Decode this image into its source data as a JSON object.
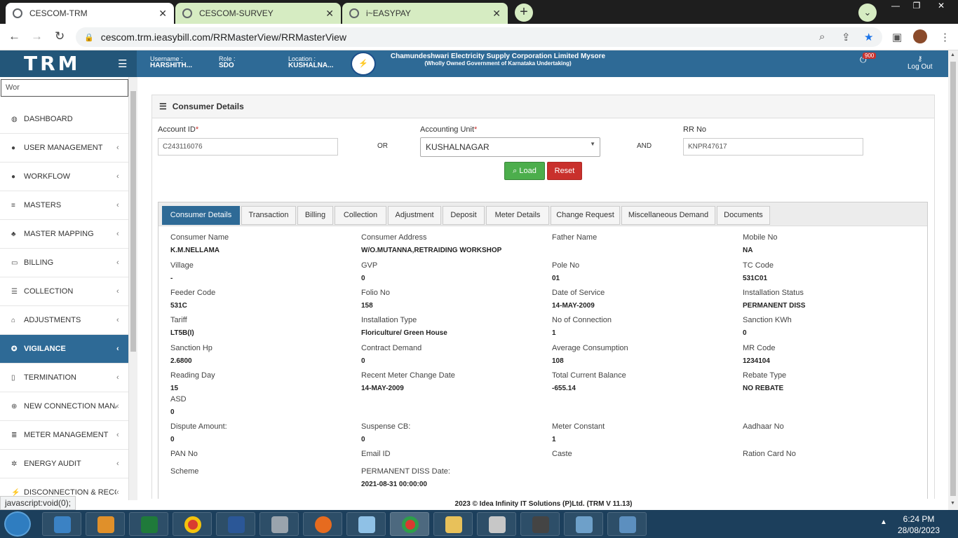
{
  "browser": {
    "tabs": [
      {
        "label": "CESCOM-TRM",
        "active": true
      },
      {
        "label": "CESCOM-SURVEY",
        "active": false
      },
      {
        "label": "i~EASYPAY",
        "active": false
      }
    ],
    "url": "cescom.trm.ieasybill.com/RRMasterView/RRMasterView",
    "status_url": "javascript:void(0);"
  },
  "header": {
    "logo": "TRM",
    "username_label": "Username :",
    "username_value": "HARSHITH...",
    "role_label": "Role :",
    "role_value": "SDO",
    "location_label": "Location :",
    "location_value": "KUSHALNA...",
    "corp_name": "Chamundeshwari Electricity Supply Corporation Limited Mysore",
    "corp_sub": "(Wholly Owned Government of Karnataka Undertaking)",
    "notif_count": "900",
    "logout": "Log Out"
  },
  "sidebar": {
    "search_value": "Wor",
    "items": [
      {
        "label": "DASHBOARD",
        "icon": "dashboard-icon",
        "glyph": "◍",
        "chevron": false
      },
      {
        "label": "USER MANAGEMENT",
        "icon": "user-icon",
        "glyph": "●",
        "chevron": true
      },
      {
        "label": "WORKFLOW",
        "icon": "user-icon",
        "glyph": "●",
        "chevron": true
      },
      {
        "label": "MASTERS",
        "icon": "list-icon",
        "glyph": "≡",
        "chevron": true
      },
      {
        "label": "MASTER MAPPING",
        "icon": "sitemap-icon",
        "glyph": "♣",
        "chevron": true
      },
      {
        "label": "BILLING",
        "icon": "monitor-icon",
        "glyph": "▭",
        "chevron": true
      },
      {
        "label": "COLLECTION",
        "icon": "list-icon",
        "glyph": "☰",
        "chevron": true
      },
      {
        "label": "ADJUSTMENTS",
        "icon": "binoculars-icon",
        "glyph": "⌂",
        "chevron": true
      },
      {
        "label": "VIGILANCE",
        "icon": "vigilance-icon",
        "glyph": "✪",
        "chevron": true,
        "active": true
      },
      {
        "label": "TERMINATION",
        "icon": "trash-icon",
        "glyph": "▯",
        "chevron": true
      },
      {
        "label": "NEW CONNECTION MANA...",
        "icon": "plus-circle-icon",
        "glyph": "⊕",
        "chevron": true
      },
      {
        "label": "METER MANAGEMENT",
        "icon": "list-icon",
        "glyph": "≣",
        "chevron": true
      },
      {
        "label": "ENERGY AUDIT",
        "icon": "cogs-icon",
        "glyph": "✲",
        "chevron": true
      },
      {
        "label": "DISCONNECTION & RECO...",
        "icon": "plug-icon",
        "glyph": "⚡",
        "chevron": true
      }
    ]
  },
  "panel": {
    "title": "Consumer Details",
    "account_label": "Account ID",
    "account_value": "C243116076",
    "or": "OR",
    "acct_unit_label": "Accounting Unit",
    "acct_unit_value": "KUSHALNAGAR",
    "and": "AND",
    "rr_label": "RR No",
    "rr_value": "KNPR47617",
    "load": "Load",
    "reset": "Reset"
  },
  "tabs": [
    "Consumer Details",
    "Transaction",
    "Billing",
    "Collection",
    "Adjustment",
    "Deposit",
    "Meter Details",
    "Change Request",
    "Miscellaneous Demand",
    "Documents"
  ],
  "details": [
    [
      {
        "label": "Consumer Name",
        "value": "K.M.NELLAMA"
      },
      {
        "label": "Consumer Address",
        "value": "W/O.MUTANNA,RETRAIDING WORKSHOP"
      },
      {
        "label": "Father Name",
        "value": ""
      },
      {
        "label": "Mobile No",
        "value": "NA"
      }
    ],
    [
      {
        "label": "Village",
        "value": "-"
      },
      {
        "label": "GVP",
        "value": "0"
      },
      {
        "label": "Pole No",
        "value": "01"
      },
      {
        "label": "TC Code",
        "value": "531C01"
      }
    ],
    [
      {
        "label": "Feeder Code",
        "value": "531C"
      },
      {
        "label": "Folio No",
        "value": "158"
      },
      {
        "label": "Date of Service",
        "value": "14-MAY-2009"
      },
      {
        "label": "Installation Status",
        "value": "PERMANENT DISS"
      }
    ],
    [
      {
        "label": "Tariff",
        "value": "LT5B(I)"
      },
      {
        "label": "Installation Type",
        "value": "Floriculture/ Green House"
      },
      {
        "label": "No of Connection",
        "value": "1"
      },
      {
        "label": "Sanction KWh",
        "value": "0"
      }
    ],
    [
      {
        "label": "Sanction Hp",
        "value": "2.6800"
      },
      {
        "label": "Contract Demand",
        "value": "0"
      },
      {
        "label": "Average Consumption",
        "value": "108"
      },
      {
        "label": "MR Code",
        "value": "1234104"
      }
    ],
    [
      {
        "label": "Reading Day",
        "value": "15"
      },
      {
        "label": "Recent Meter Change Date",
        "value": "14-MAY-2009"
      },
      {
        "label": "Total Current Balance",
        "value": "-655.14"
      },
      {
        "label": "Rebate Type",
        "value": "NO REBATE"
      }
    ],
    [
      {
        "label": "ASD",
        "value": "0"
      }
    ],
    [
      {
        "label": "Dispute Amount:",
        "value": "0"
      },
      {
        "label": "Suspense CB:",
        "value": "0"
      },
      {
        "label": "Meter Constant",
        "value": "1"
      },
      {
        "label": "Aadhaar No",
        "value": ""
      }
    ],
    [
      {
        "label": "PAN No",
        "value": ""
      },
      {
        "label": "Email ID",
        "value": ""
      },
      {
        "label": "Caste",
        "value": ""
      },
      {
        "label": "Ration Card No",
        "value": ""
      }
    ],
    [
      {
        "label": "Scheme",
        "value": ""
      },
      {
        "label": "PERMANENT DISS Date:",
        "value": "2021-08-31 00:00:00"
      }
    ]
  ],
  "footer": "2023 © Idea Infinity IT Solutions (P)Ltd. (TRM V 11.13)",
  "taskbar": {
    "time": "6:24 PM",
    "date": "28/08/2023"
  },
  "colors": {
    "header": "#2e6a96",
    "load": "#4cae4c",
    "reset": "#c9302c"
  }
}
